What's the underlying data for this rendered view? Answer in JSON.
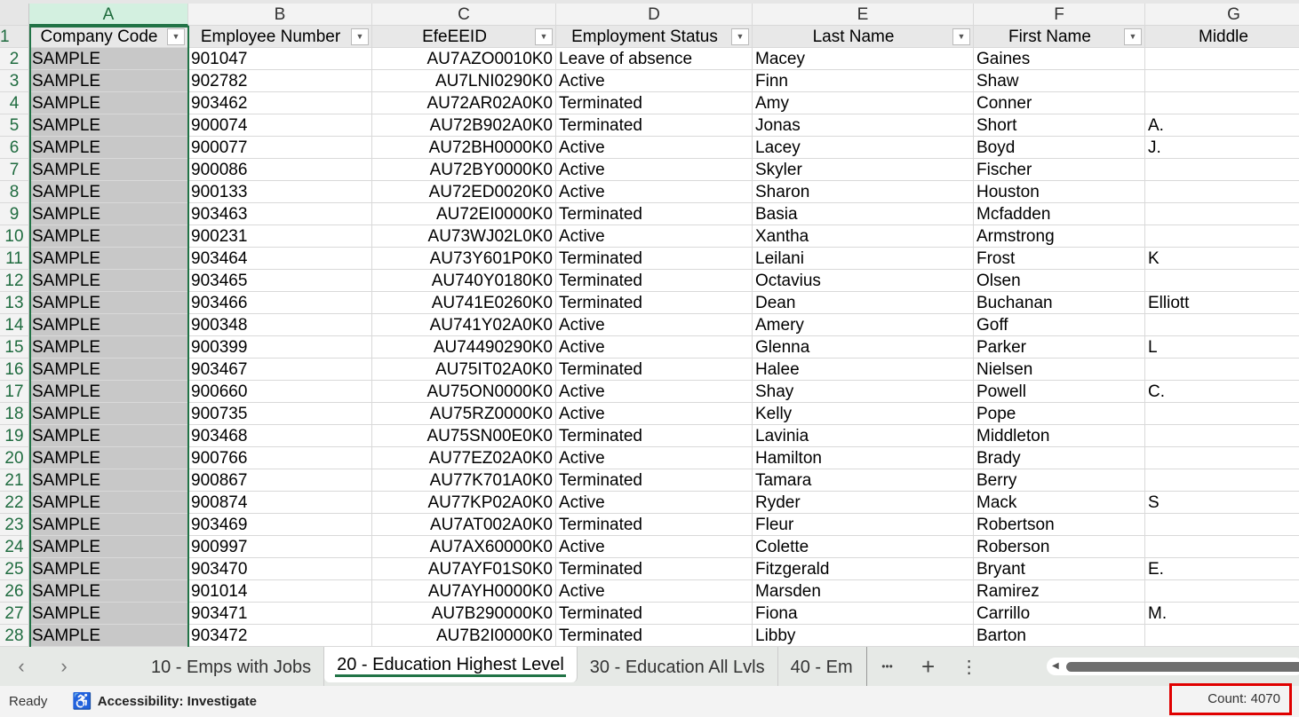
{
  "columns": [
    "A",
    "B",
    "C",
    "D",
    "E",
    "F",
    "G"
  ],
  "headers": [
    "Company Code",
    "Employee Number",
    "EfeEEID",
    "Employment Status",
    "Last Name",
    "First Name",
    "Middle"
  ],
  "rows": [
    [
      "SAMPLE",
      "901047",
      "AU7AZO0010K0",
      "Leave of absence",
      "Macey",
      "Gaines",
      ""
    ],
    [
      "SAMPLE",
      "902782",
      "AU7LNI0290K0",
      "Active",
      "Finn",
      "Shaw",
      ""
    ],
    [
      "SAMPLE",
      "903462",
      "AU72AR02A0K0",
      "Terminated",
      "Amy",
      "Conner",
      ""
    ],
    [
      "SAMPLE",
      "900074",
      "AU72B902A0K0",
      "Terminated",
      "Jonas",
      "Short",
      "A."
    ],
    [
      "SAMPLE",
      "900077",
      "AU72BH0000K0",
      "Active",
      "Lacey",
      "Boyd",
      "J."
    ],
    [
      "SAMPLE",
      "900086",
      "AU72BY0000K0",
      "Active",
      "Skyler",
      "Fischer",
      ""
    ],
    [
      "SAMPLE",
      "900133",
      "AU72ED0020K0",
      "Active",
      "Sharon",
      "Houston",
      ""
    ],
    [
      "SAMPLE",
      "903463",
      "AU72EI0000K0",
      "Terminated",
      "Basia",
      "Mcfadden",
      ""
    ],
    [
      "SAMPLE",
      "900231",
      "AU73WJ02L0K0",
      "Active",
      "Xantha",
      "Armstrong",
      ""
    ],
    [
      "SAMPLE",
      "903464",
      "AU73Y601P0K0",
      "Terminated",
      "Leilani",
      "Frost",
      "K"
    ],
    [
      "SAMPLE",
      "903465",
      "AU740Y0180K0",
      "Terminated",
      "Octavius",
      "Olsen",
      ""
    ],
    [
      "SAMPLE",
      "903466",
      "AU741E0260K0",
      "Terminated",
      "Dean",
      "Buchanan",
      "Elliott"
    ],
    [
      "SAMPLE",
      "900348",
      "AU741Y02A0K0",
      "Active",
      "Amery",
      "Goff",
      ""
    ],
    [
      "SAMPLE",
      "900399",
      "AU74490290K0",
      "Active",
      "Glenna",
      "Parker",
      "L"
    ],
    [
      "SAMPLE",
      "903467",
      "AU75IT02A0K0",
      "Terminated",
      "Halee",
      "Nielsen",
      ""
    ],
    [
      "SAMPLE",
      "900660",
      "AU75ON0000K0",
      "Active",
      "Shay",
      "Powell",
      "C."
    ],
    [
      "SAMPLE",
      "900735",
      "AU75RZ0000K0",
      "Active",
      "Kelly",
      "Pope",
      ""
    ],
    [
      "SAMPLE",
      "903468",
      "AU75SN00E0K0",
      "Terminated",
      "Lavinia",
      "Middleton",
      ""
    ],
    [
      "SAMPLE",
      "900766",
      "AU77EZ02A0K0",
      "Active",
      "Hamilton",
      "Brady",
      ""
    ],
    [
      "SAMPLE",
      "900867",
      "AU77K701A0K0",
      "Terminated",
      "Tamara",
      "Berry",
      ""
    ],
    [
      "SAMPLE",
      "900874",
      "AU77KP02A0K0",
      "Active",
      "Ryder",
      "Mack",
      "S"
    ],
    [
      "SAMPLE",
      "903469",
      "AU7AT002A0K0",
      "Terminated",
      "Fleur",
      "Robertson",
      ""
    ],
    [
      "SAMPLE",
      "900997",
      "AU7AX60000K0",
      "Active",
      "Colette",
      "Roberson",
      ""
    ],
    [
      "SAMPLE",
      "903470",
      "AU7AYF01S0K0",
      "Terminated",
      "Fitzgerald",
      "Bryant",
      "E."
    ],
    [
      "SAMPLE",
      "901014",
      "AU7AYH0000K0",
      "Active",
      "Marsden",
      "Ramirez",
      ""
    ],
    [
      "SAMPLE",
      "903471",
      "AU7B290000K0",
      "Terminated",
      "Fiona",
      "Carrillo",
      "M."
    ],
    [
      "SAMPLE",
      "903472",
      "AU7B2I0000K0",
      "Terminated",
      "Libby",
      "Barton",
      ""
    ]
  ],
  "sheet_tabs": [
    "10 - Emps with Jobs",
    "20 - Education Highest Level",
    "30 - Education All Lvls",
    "40 - Em"
  ],
  "active_tab": 1,
  "tab_controls": {
    "prev": "‹",
    "next": "›",
    "more": "•••",
    "add": "+",
    "options": "⋮"
  },
  "status": {
    "ready": "Ready",
    "accessibility": "Accessibility: Investigate",
    "count": "Count: 4070"
  },
  "colors": {
    "accent": "#217346",
    "selection": "#c8c8c8",
    "highlight_box": "#e00000"
  }
}
